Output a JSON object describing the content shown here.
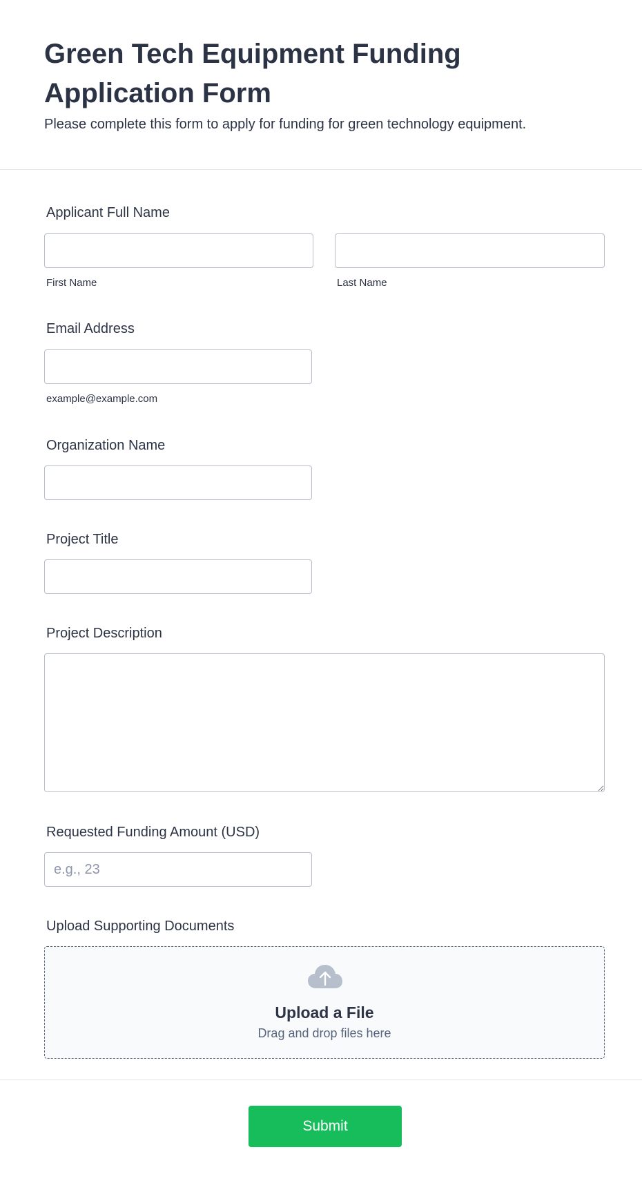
{
  "header": {
    "title": "Green Tech Equipment Funding Application Form",
    "subtitle": "Please complete this form to apply for funding for green technology equipment."
  },
  "fields": {
    "full_name": {
      "label": "Applicant Full Name",
      "first_sublabel": "First Name",
      "last_sublabel": "Last Name",
      "first_value": "",
      "last_value": ""
    },
    "email": {
      "label": "Email Address",
      "sublabel": "example@example.com",
      "value": ""
    },
    "organization": {
      "label": "Organization Name",
      "value": ""
    },
    "project_title": {
      "label": "Project Title",
      "value": ""
    },
    "project_description": {
      "label": "Project Description",
      "value": ""
    },
    "funding_amount": {
      "label": "Requested Funding Amount (USD)",
      "placeholder": "e.g., 23",
      "value": ""
    },
    "upload": {
      "label": "Upload Supporting Documents",
      "title": "Upload a File",
      "hint": "Drag and drop files here",
      "icon": "cloud-upload-icon"
    }
  },
  "submit": {
    "label": "Submit"
  },
  "colors": {
    "accent": "#18bd5b",
    "text": "#2c3345",
    "border": "#b8bdc9",
    "muted": "#57647e"
  }
}
